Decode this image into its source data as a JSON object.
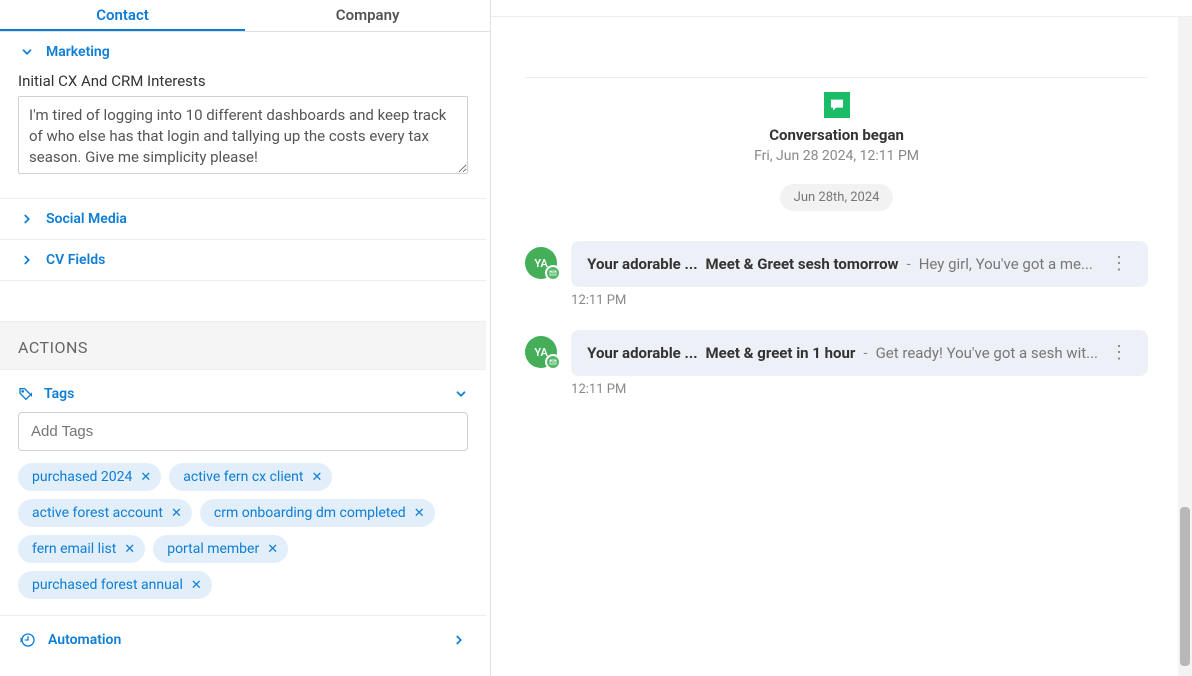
{
  "tabs": {
    "contact": "Contact",
    "company": "Company"
  },
  "sections": {
    "marketing": {
      "title": "Marketing"
    },
    "interests_label": "Initial CX And CRM Interests",
    "interests_value": "I'm tired of logging into 10 different dashboards and keep track of who else has that login and tallying up the costs every tax season. Give me simplicity please!",
    "social": {
      "title": "Social Media"
    },
    "cv": {
      "title": "CV Fields"
    }
  },
  "actions": {
    "header": "ACTIONS",
    "tags_label": "Tags",
    "tags_placeholder": "Add Tags",
    "tags": [
      "purchased 2024",
      "active fern cx client",
      "active forest account",
      "crm onboarding dm completed",
      "fern email list",
      "portal member",
      "purchased forest annual"
    ],
    "automation": "Automation"
  },
  "conversation": {
    "began_title": "Conversation began",
    "began_date": "Fri, Jun 28 2024, 12:11 PM",
    "date_divider": "Jun 28th, 2024",
    "avatar_initials": "YA",
    "messages": [
      {
        "from": "Your adorable ...",
        "subject": "Meet & Greet sesh tomorrow",
        "preview": "Hey girl, You've got a me...",
        "time": "12:11 PM"
      },
      {
        "from": "Your adorable ...",
        "subject": "Meet & greet in 1 hour",
        "preview": "Get ready! You've got a sesh wit...",
        "time": "12:11 PM"
      }
    ]
  }
}
